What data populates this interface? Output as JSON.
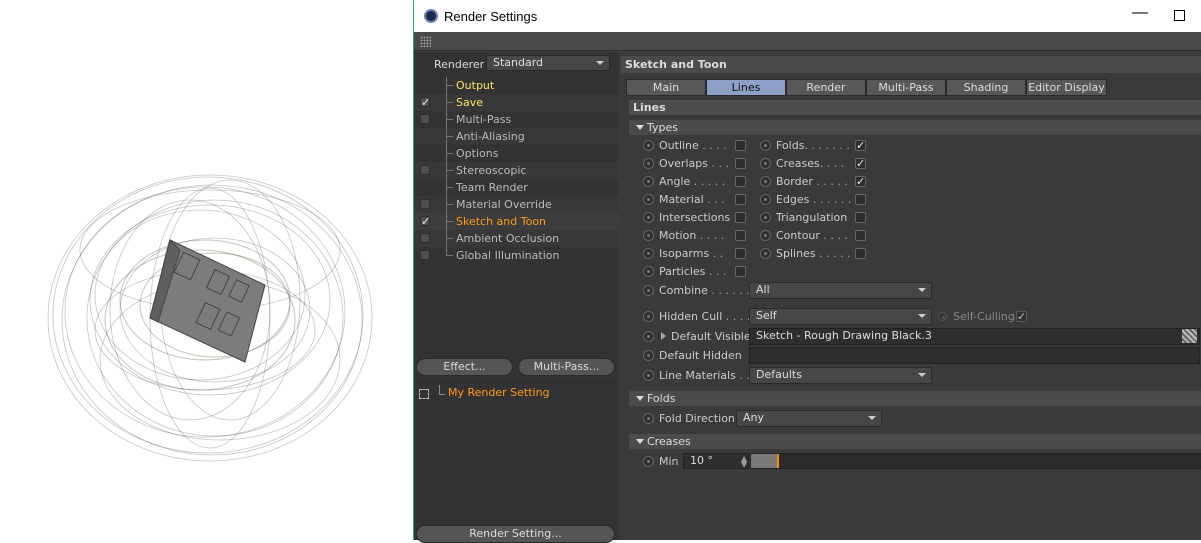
{
  "window": {
    "title": "Render Settings"
  },
  "left": {
    "renderer_label": "Renderer",
    "renderer_value": "Standard",
    "tree": [
      {
        "label": "Output",
        "check": "none",
        "color": "yellow"
      },
      {
        "label": "Save",
        "check": "checked",
        "color": "yellow"
      },
      {
        "label": "Multi-Pass",
        "check": "empty",
        "color": "normal"
      },
      {
        "label": "Anti-Aliasing",
        "check": "none",
        "color": "normal"
      },
      {
        "label": "Options",
        "check": "none",
        "color": "normal"
      },
      {
        "label": "Stereoscopic",
        "check": "empty",
        "color": "normal"
      },
      {
        "label": "Team Render",
        "check": "none",
        "color": "normal"
      },
      {
        "label": "Material Override",
        "check": "empty",
        "color": "normal"
      },
      {
        "label": "Sketch and Toon",
        "check": "checked",
        "color": "orange"
      },
      {
        "label": "Ambient Occlusion",
        "check": "empty",
        "color": "normal"
      },
      {
        "label": "Global Illumination",
        "check": "empty",
        "color": "normal"
      }
    ],
    "effect_button": "Effect...",
    "multipass_button": "Multi-Pass...",
    "setting_name": "My Render Setting",
    "render_setting_button": "Render Setting..."
  },
  "right": {
    "header": "Sketch and Toon",
    "tabs": [
      "Main",
      "Lines",
      "Render",
      "Multi-Pass",
      "Shading",
      "Editor Display"
    ],
    "active_tab": "Lines",
    "lines_header": "Lines",
    "types_header": "Types",
    "types_left": [
      {
        "label": "Outline",
        "dots": " . . . .",
        "checked": false
      },
      {
        "label": "Overlaps",
        "dots": " . . .",
        "checked": false
      },
      {
        "label": "Angle",
        "dots": " . . . . .",
        "checked": false
      },
      {
        "label": "Material",
        "dots": " . . .",
        "checked": false
      },
      {
        "label": "Intersections",
        "dots": "",
        "checked": false
      },
      {
        "label": "Motion",
        "dots": " . . . .",
        "checked": false
      },
      {
        "label": "Isoparms",
        "dots": " . .",
        "checked": false
      },
      {
        "label": "Particles",
        "dots": " . . .",
        "checked": false
      }
    ],
    "types_right": [
      {
        "label": "Folds",
        "dots": ". . . . . . .",
        "checked": true
      },
      {
        "label": "Creases",
        "dots": ". . . .",
        "checked": true
      },
      {
        "label": "Border",
        "dots": " . . . . .",
        "checked": true
      },
      {
        "label": "Edges",
        "dots": " . . . . . .",
        "checked": false
      },
      {
        "label": "Triangulation",
        "dots": "",
        "checked": false
      },
      {
        "label": "Contour",
        "dots": " . . . .",
        "checked": false
      },
      {
        "label": "Splines",
        "dots": " . . . . .",
        "checked": false
      }
    ],
    "combine_label": "Combine",
    "combine_dots": " . . . . . . .",
    "combine_value": "All",
    "hidden_cull_label": "Hidden Cull",
    "hidden_cull_dots": " . . . .",
    "hidden_cull_value": "Self",
    "self_culling_label": "Self-Culling",
    "self_culling_checked": true,
    "default_visible_label": "Default Visible",
    "default_visible_value": "Sketch - Rough Drawing Black.3",
    "default_hidden_label": "Default Hidden",
    "default_hidden_value": "",
    "line_materials_label": "Line Materials",
    "line_materials_dots": " . .",
    "line_materials_value": "Defaults",
    "folds_header": "Folds",
    "fold_direction_label": "Fold Direction",
    "fold_direction_value": "Any",
    "creases_header": "Creases",
    "min_label": "Min",
    "min_value": "10 °",
    "min_slider_fraction": 0.06
  }
}
